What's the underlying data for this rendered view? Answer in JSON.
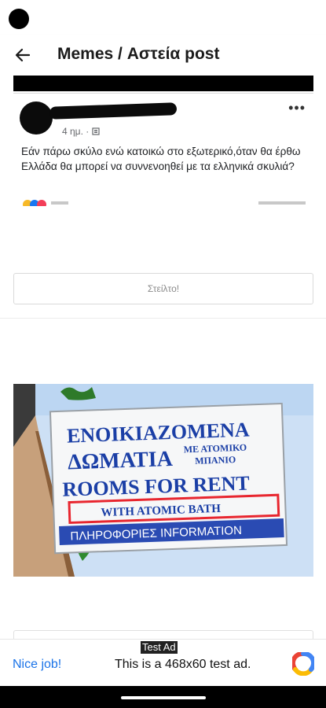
{
  "app_bar": {
    "title": "Memes / Αστεία post",
    "back_icon": "arrow-back-icon"
  },
  "post": {
    "time": "4 ημ. ·",
    "privacy_icon": "friends-icon",
    "more_label": "•••",
    "text": "Εάν πάρω σκύλο ενώ κατοικώ στο εξωτερικό,όταν θα έρθω Ελλάδα  θα μπορεί να συννενοηθεί με τα ελληνικά σκυλιά?"
  },
  "cta": {
    "label": "Στείλτο!"
  },
  "meme_sign": {
    "line1": "ΕΝΟΙΚΙΑΖΟΜΕΝΑ",
    "line2": "ΔΩΜΑΤΙΑ",
    "line2_small_a": "ΜΕ ΑΤΟΜΙΚΟ",
    "line2_small_b": "ΜΠΑΝΙΟ",
    "line3": "ROOMS FOR RENT",
    "line4": "WITH ATOMIC BATH",
    "line5": "ΠΛΗΡΟΦΟΡΙΕΣ INFORMATION",
    "highlight_color": "#e8262f",
    "sign_text_color": "#1b3fa6"
  },
  "ad": {
    "label": "Test Ad",
    "nice": "Nice job!",
    "text": "This is a 468x60 test ad.",
    "logo_icon": "ad-network-logo-icon"
  }
}
